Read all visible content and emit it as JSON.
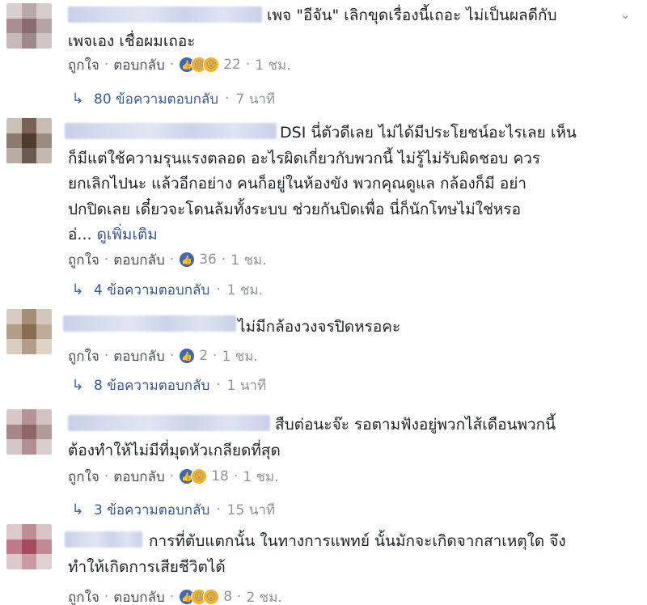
{
  "labels": {
    "like": "ถูกใจ",
    "reply": "ตอบกลับ",
    "dot": "·"
  },
  "comments": [
    {
      "text": "เพจ \"อีจัน\" เลิกขุดเรื่องนี้เถอะ ไม่เป็นผลดีกับ\nเพจเอง เชื่อผมเถอะ",
      "reactions": [
        "like",
        "haha",
        "wow"
      ],
      "count": "22",
      "time": "1 ชม.",
      "replies": "80 ข้อความตอบกลับ",
      "reply_time": "7 นาที"
    },
    {
      "text": "DSI นี่ตัวดีเลย ไม่ได้มีประโยชน์อะไรเลย เห็น\nก็มีแต่ใช้ความรุนแรงตลอด อะไรผิดเกี่ยวกับพวกนี้ ไม่รู้ไม่รับผิดชอบ ควร\nยกเลิกไปนะ แล้วอีกอย่าง คนก็อยู่ในห้องขัง พวกคุณดูแล กล้องก็มี อย่า\nปกปิดเลย เดี๋ยวจะโดนล้มทั้งระบบ ช่วยกันปิดเพื่อ นี่ก็นักโทษไม่ใช่หรอ\nอ่...",
      "see_more": "ดูเพิ่มเติม",
      "reactions": [
        "like"
      ],
      "count": "36",
      "time": "1 ชม.",
      "replies": "4 ข้อความตอบกลับ",
      "reply_time": "1 ชม."
    },
    {
      "text": "ไม่มีกล้องวงจรปิดหรอคะ",
      "reactions": [
        "like"
      ],
      "count": "2",
      "time": "1 ชม.",
      "replies": "8 ข้อความตอบกลับ",
      "reply_time": "1 นาที"
    },
    {
      "text": "สืบต่อนะจ๊ะ รอตามฟังอยู่พวกไส้เดือนพวกนี้\nต้องทำให้ไม่มีที่มุดหัวเกลียดที่สุด",
      "reactions": [
        "like",
        "wow"
      ],
      "count": "18",
      "time": "1 ชม.",
      "replies": "3 ข้อความตอบกลับ",
      "reply_time": "15 นาที"
    },
    {
      "text": "การที่ตับแตกนั้น ในทางการแพทย์ นั้นมักจะเกิดจากสาเหตุใด จึง\nทำให้เกิดการเสียชีวิตได้",
      "reactions": [
        "like",
        "haha",
        "wow"
      ],
      "count": "8",
      "time": "2 ชม."
    }
  ],
  "colors": {
    "link": "#365899",
    "meta": "#90949c",
    "like_blue": "#4267b2",
    "emoji_yellow": "#f7b125"
  }
}
